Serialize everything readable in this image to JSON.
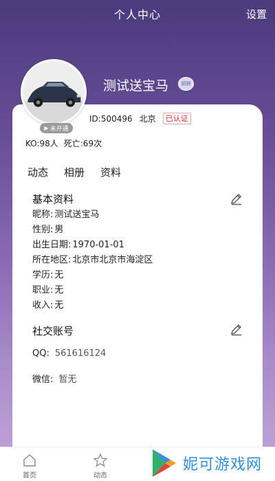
{
  "header": {
    "title": "个人中心",
    "settings_label": "设置"
  },
  "profile": {
    "nickname": "测试送宝马",
    "vip_badge_text": "铜牌",
    "avatar_badge_text": "未开通",
    "id_text": "ID:500496",
    "city": "北京",
    "cert_text": "已认证",
    "ko_text": "KO:98人",
    "death_text": "死亡:69次"
  },
  "tabs": [
    "动态",
    "相册",
    "资料"
  ],
  "basic_info": {
    "title": "基本资料",
    "rows": [
      {
        "label": "昵称:",
        "value": "测试送宝马"
      },
      {
        "label": "性别:",
        "value": "男"
      },
      {
        "label": "出生日期:",
        "value": "1970-01-01"
      },
      {
        "label": "所在地区:",
        "value": "北京市北京市海淀区"
      },
      {
        "label": "学历:",
        "value": "无"
      },
      {
        "label": "职业:",
        "value": "无"
      },
      {
        "label": "收入:",
        "value": "无"
      }
    ]
  },
  "social": {
    "title": "社交账号",
    "rows": [
      {
        "label": "QQ:",
        "value": "561616124"
      },
      {
        "label": "微信:",
        "value": "暂无"
      }
    ]
  },
  "tabbar": {
    "items": [
      {
        "label": "首页",
        "icon": "home-icon"
      },
      {
        "label": "动态",
        "icon": "star-icon"
      }
    ]
  },
  "watermark": {
    "text": "妮可游戏网",
    "icon": "play-triangle-logo"
  },
  "colors": {
    "bg_top": "#4b3a7c",
    "bg_bottom": "#c4a8d9",
    "cert_red": "#cc3333",
    "watermark_blue": "#2f8fd8"
  }
}
